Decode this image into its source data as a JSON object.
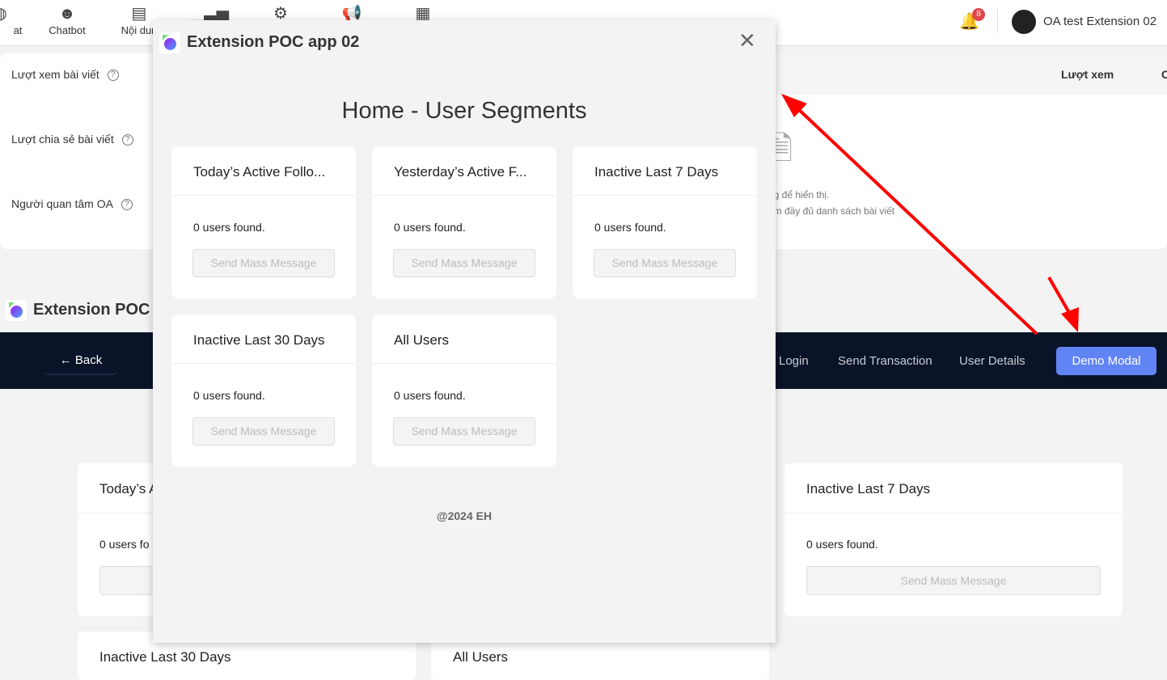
{
  "topnav": {
    "items": [
      {
        "label": "at",
        "icon": "chat-icon"
      },
      {
        "label": "Chatbot",
        "icon": "robot-icon"
      },
      {
        "label": "Nội dun",
        "icon": "document-icon"
      },
      {
        "label": "",
        "icon": "chart-icon"
      },
      {
        "label": "",
        "icon": "gear-icon"
      },
      {
        "label": "",
        "icon": "megaphone-icon"
      },
      {
        "label": "",
        "icon": "apps-icon"
      }
    ],
    "notification_count": "8",
    "account_name": "OA test Extension 02"
  },
  "stats": {
    "items": [
      "Lượt xem bài viết",
      "Lượt chia sẻ bài viết",
      "Người quan tâm OA"
    ],
    "column_header": "Lượt xem",
    "column_header_2": "C",
    "empty_line1": "ng để hiển thị.",
    "empty_line2": "em đầy đủ danh sách bài viết"
  },
  "background_app": {
    "title": "Extension POC",
    "back_label": "Back",
    "nav": [
      "Login",
      "Send Transaction",
      "User Details"
    ],
    "demo_button": "Demo Modal",
    "cards": [
      {
        "title": "Today’s A",
        "count": "0 users fo"
      },
      {
        "title": "Inactive Last 7 Days",
        "count": "0 users found.",
        "button": "Send Mass Message"
      },
      {
        "title": "Inactive Last 30 Days"
      },
      {
        "title": "All Users"
      }
    ]
  },
  "modal": {
    "title": "Extension POC app 02",
    "heading": "Home - User Segments",
    "footer": "@2024 EH",
    "segments": [
      {
        "title": "Today’s Active Follo...",
        "count": "0 users found.",
        "button": "Send Mass Message"
      },
      {
        "title": "Yesterday’s Active F...",
        "count": "0 users found.",
        "button": "Send Mass Message"
      },
      {
        "title": "Inactive Last 7 Days",
        "count": "0 users found.",
        "button": "Send Mass Message"
      },
      {
        "title": "Inactive Last 30 Days",
        "count": "0 users found.",
        "button": "Send Mass Message"
      },
      {
        "title": "All Users",
        "count": "0 users found.",
        "button": "Send Mass Message"
      }
    ]
  },
  "colors": {
    "accent": "#6184f5",
    "dark_nav": "#0a1428",
    "annotation": "#ff0000"
  }
}
